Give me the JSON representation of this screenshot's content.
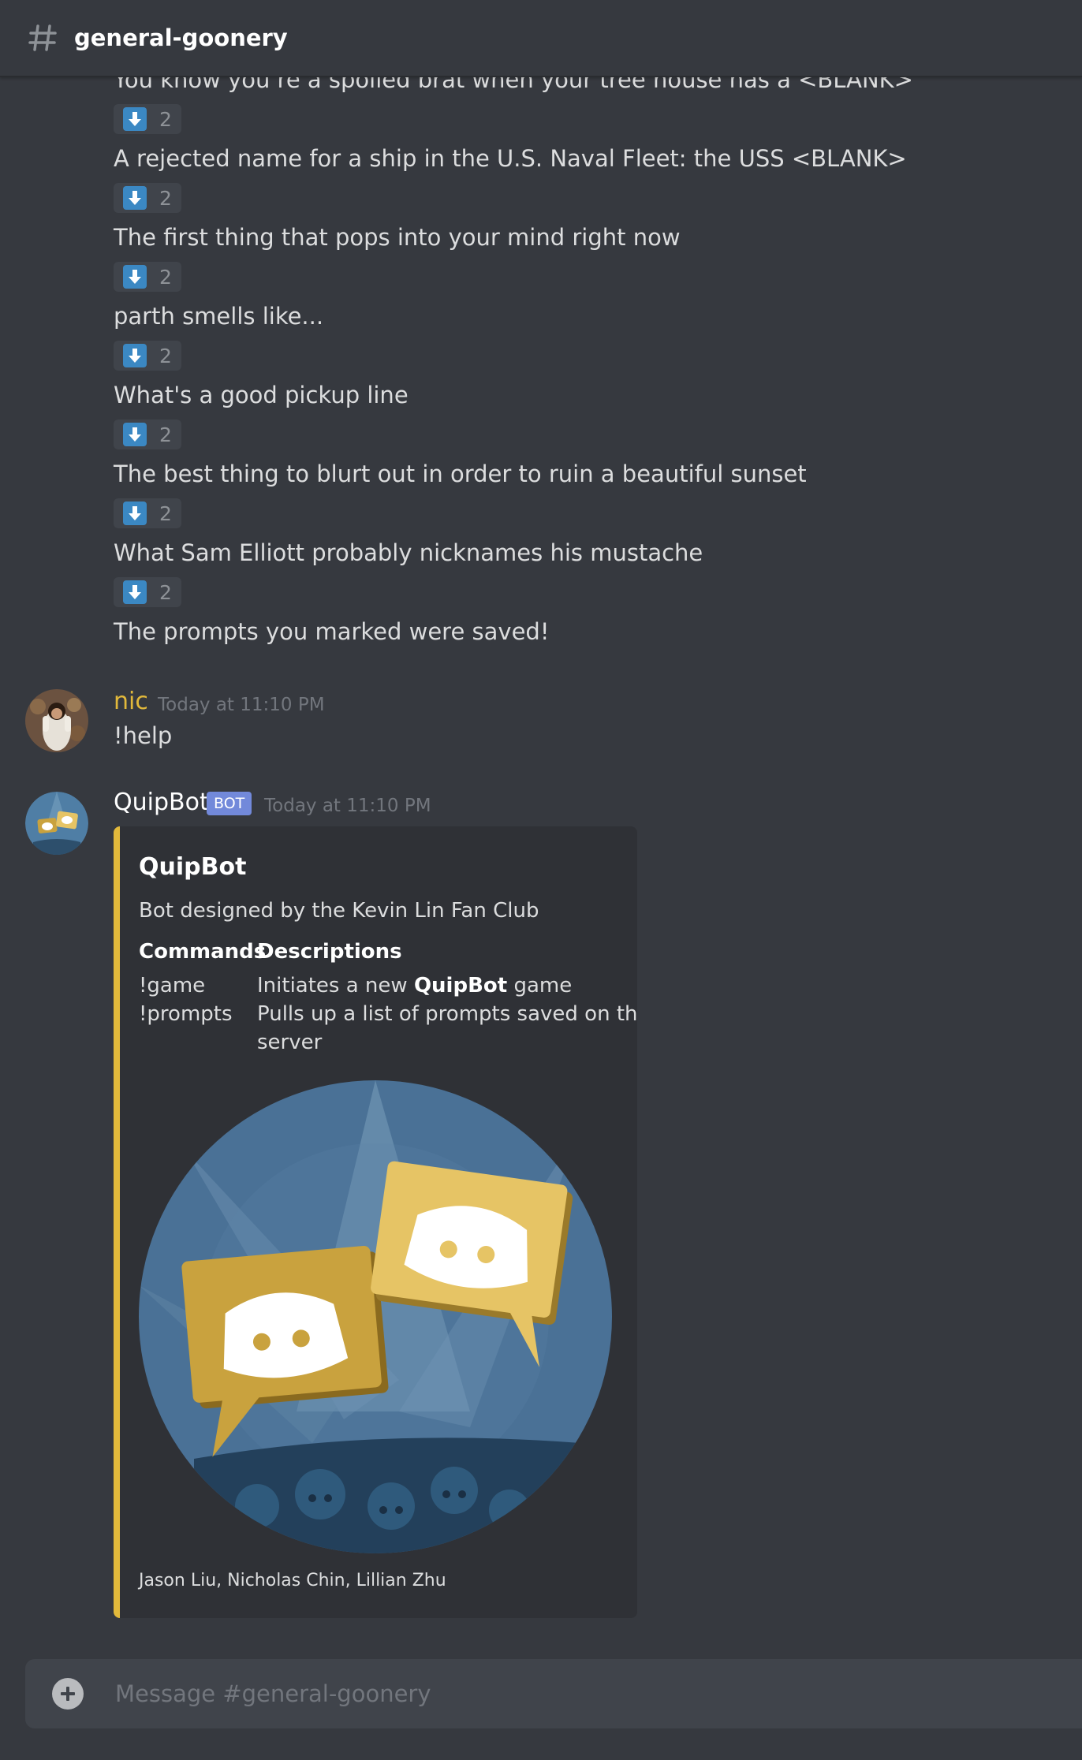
{
  "channel": {
    "name": "general-goonery",
    "icon": "hash-icon"
  },
  "prompts": [
    {
      "text": "You know you’re a spoiled brat when your tree house has a <BLANK>",
      "reaction_emoji": "arrow-down-icon",
      "reaction_count": "2"
    },
    {
      "text": "A rejected name for a ship in the U.S. Naval Fleet: the USS <BLANK>",
      "reaction_emoji": "arrow-down-icon",
      "reaction_count": "2"
    },
    {
      "text": "The first thing that pops into your mind right now",
      "reaction_emoji": "arrow-down-icon",
      "reaction_count": "2"
    },
    {
      "text": "parth smells like...",
      "reaction_emoji": "arrow-down-icon",
      "reaction_count": "2"
    },
    {
      "text": "What's a good pickup line",
      "reaction_emoji": "arrow-down-icon",
      "reaction_count": "2"
    },
    {
      "text": "The best thing to blurt out in order to ruin a beautiful sunset",
      "reaction_emoji": "arrow-down-icon",
      "reaction_count": "2"
    },
    {
      "text": "What Sam Elliott probably nicknames his mustache",
      "reaction_emoji": "arrow-down-icon",
      "reaction_count": "2"
    }
  ],
  "saved_notice": "The prompts you marked were saved!",
  "messages": [
    {
      "author": "nic",
      "author_color": "#e2b93b",
      "timestamp": "Today at 11:10 PM",
      "text": "!help"
    },
    {
      "author": "QuipBot",
      "author_color": "#ffffff",
      "bot_tag": "BOT",
      "timestamp": "Today at 11:10 PM"
    }
  ],
  "embed": {
    "accent_color": "#e2b93b",
    "title": "QuipBot",
    "description": "Bot designed by the Kevin Lin Fan Club",
    "fields": {
      "commands_name": "Commands",
      "descriptions_name": "Descriptions",
      "commands": [
        "!game",
        "!prompts"
      ],
      "descriptions": {
        "game_prefix": "Initiates a new ",
        "game_bold": "QuipBot",
        "game_suffix": " game",
        "prompts_line1": "Pulls up a list of prompts saved on this",
        "prompts_line2": "server"
      }
    },
    "footer": "Jason Liu, Nicholas Chin, Lillian Zhu"
  },
  "composer": {
    "placeholder": "Message #general-goonery",
    "attach_icon": "plus-circle-icon"
  }
}
